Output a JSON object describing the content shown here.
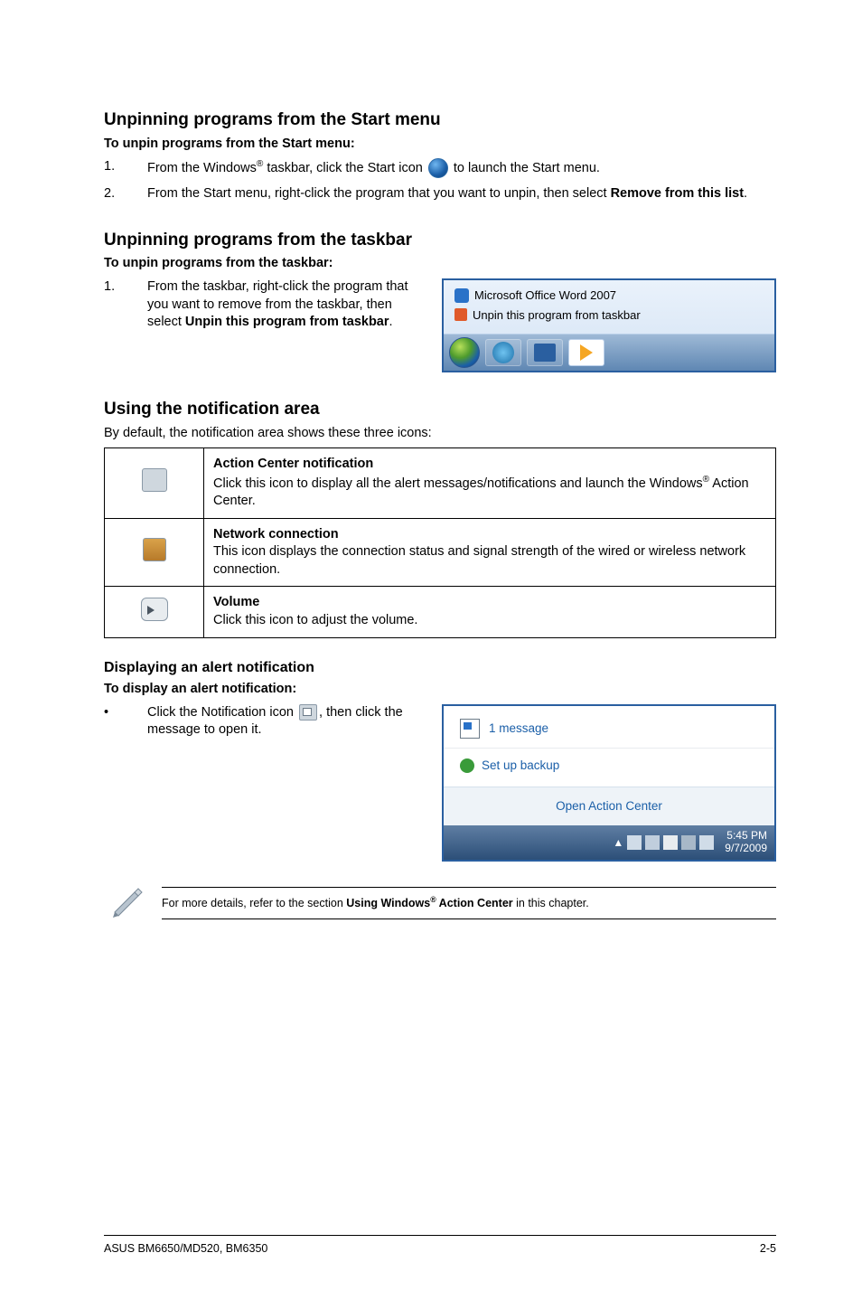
{
  "sections": {
    "unpin_start": {
      "heading": "Unpinning programs from the Start menu",
      "subhead": "To unpin programs from the Start menu:",
      "step1_pre": "From the Windows",
      "step1_mid": " taskbar, click the Start icon ",
      "step1_post": " to launch the Start menu.",
      "step2_pre": "From the Start menu, right-click the program that you want to unpin, then select ",
      "step2_bold": "Remove from this list",
      "step2_post": "."
    },
    "unpin_taskbar": {
      "heading": "Unpinning programs from the taskbar",
      "subhead": "To unpin programs from the taskbar:",
      "step1_pre": "From the taskbar, right-click the program that you want to remove from the taskbar, then select ",
      "step1_bold": "Unpin this program from taskbar",
      "step1_post": ".",
      "window": {
        "line1": "Microsoft Office Word 2007",
        "line2": "Unpin this program from taskbar"
      }
    },
    "notif": {
      "heading": "Using the notification area",
      "intro": "By default, the notification area shows these three icons:",
      "rows": [
        {
          "title": "Action Center notification",
          "desc_pre": "Click this icon to display all the alert messages/notifications and launch the Windows",
          "desc_post": " Action Center."
        },
        {
          "title": "Network connection",
          "desc": "This icon displays the connection status and signal strength of the wired or wireless network connection."
        },
        {
          "title": "Volume",
          "desc": "Click this icon to adjust the volume."
        }
      ]
    },
    "alert": {
      "heading": "Displaying an alert notification",
      "subhead": "To display an alert notification:",
      "bullet_pre": "Click the Notification icon ",
      "bullet_post": ", then click the message to open it.",
      "window": {
        "msg": "1 message",
        "setup": "Set up backup",
        "oac": "Open Action Center",
        "time": "5:45 PM",
        "date": "9/7/2009"
      }
    },
    "note": {
      "pre": "For more details, refer to the section ",
      "bold_pre": "Using Windows",
      "bold_post": " Action Center",
      "post": " in this chapter."
    }
  },
  "footer": {
    "left": "ASUS BM6650/MD520, BM6350",
    "right": "2-5"
  },
  "labels": {
    "num1": "1.",
    "num2": "2.",
    "dot": "•",
    "reg": "®"
  }
}
